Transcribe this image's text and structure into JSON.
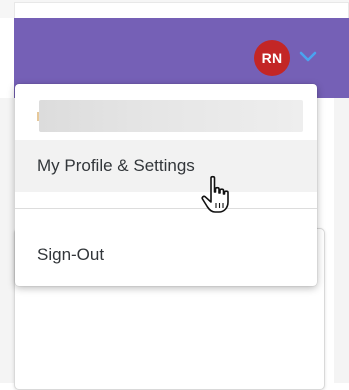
{
  "header": {
    "avatar_initials": "RN",
    "avatar_color": "#c32626",
    "bar_color": "#7560b6",
    "chevron_icon": "chevron-down-icon",
    "chevron_color": "#4aa3f0"
  },
  "menu": {
    "items": [
      {
        "label": "My Profile & Settings"
      },
      {
        "label": "Sign-Out"
      }
    ]
  },
  "cursor": {
    "icon": "hand-pointer-icon"
  }
}
